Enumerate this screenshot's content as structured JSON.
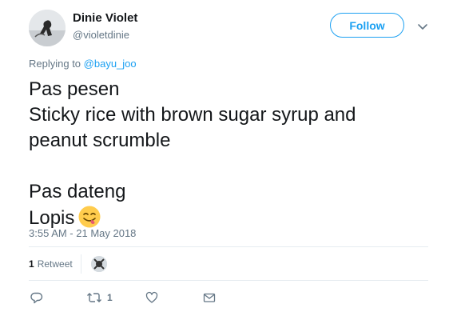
{
  "author": {
    "name": "Dinie Violet",
    "handle": "@violetdinie",
    "avatar_icon": "profile-photo"
  },
  "header": {
    "follow_label": "Follow",
    "menu_icon": "chevron-down-icon"
  },
  "reply": {
    "prefix": "Replying to",
    "mention": "@bayu_joo"
  },
  "tweet": {
    "lines": [
      "Pas pesen",
      "Sticky rice with brown sugar syrup and",
      "peanut scrumble",
      "",
      "Pas dateng",
      "Lopis"
    ],
    "emoji": "face-savoring-food"
  },
  "timestamp": "3:55 AM - 21 May 2018",
  "stats": {
    "retweet_count": "1",
    "retweet_label": "Retweet"
  },
  "actions": {
    "reply_icon": "reply-icon",
    "retweet_icon": "retweet-icon",
    "retweet_count": "1",
    "like_icon": "heart-icon",
    "dm_icon": "mail-icon"
  },
  "colors": {
    "accent": "#1da1f2",
    "text": "#14171a",
    "muted": "#657786",
    "divider": "#e6ecf0"
  }
}
